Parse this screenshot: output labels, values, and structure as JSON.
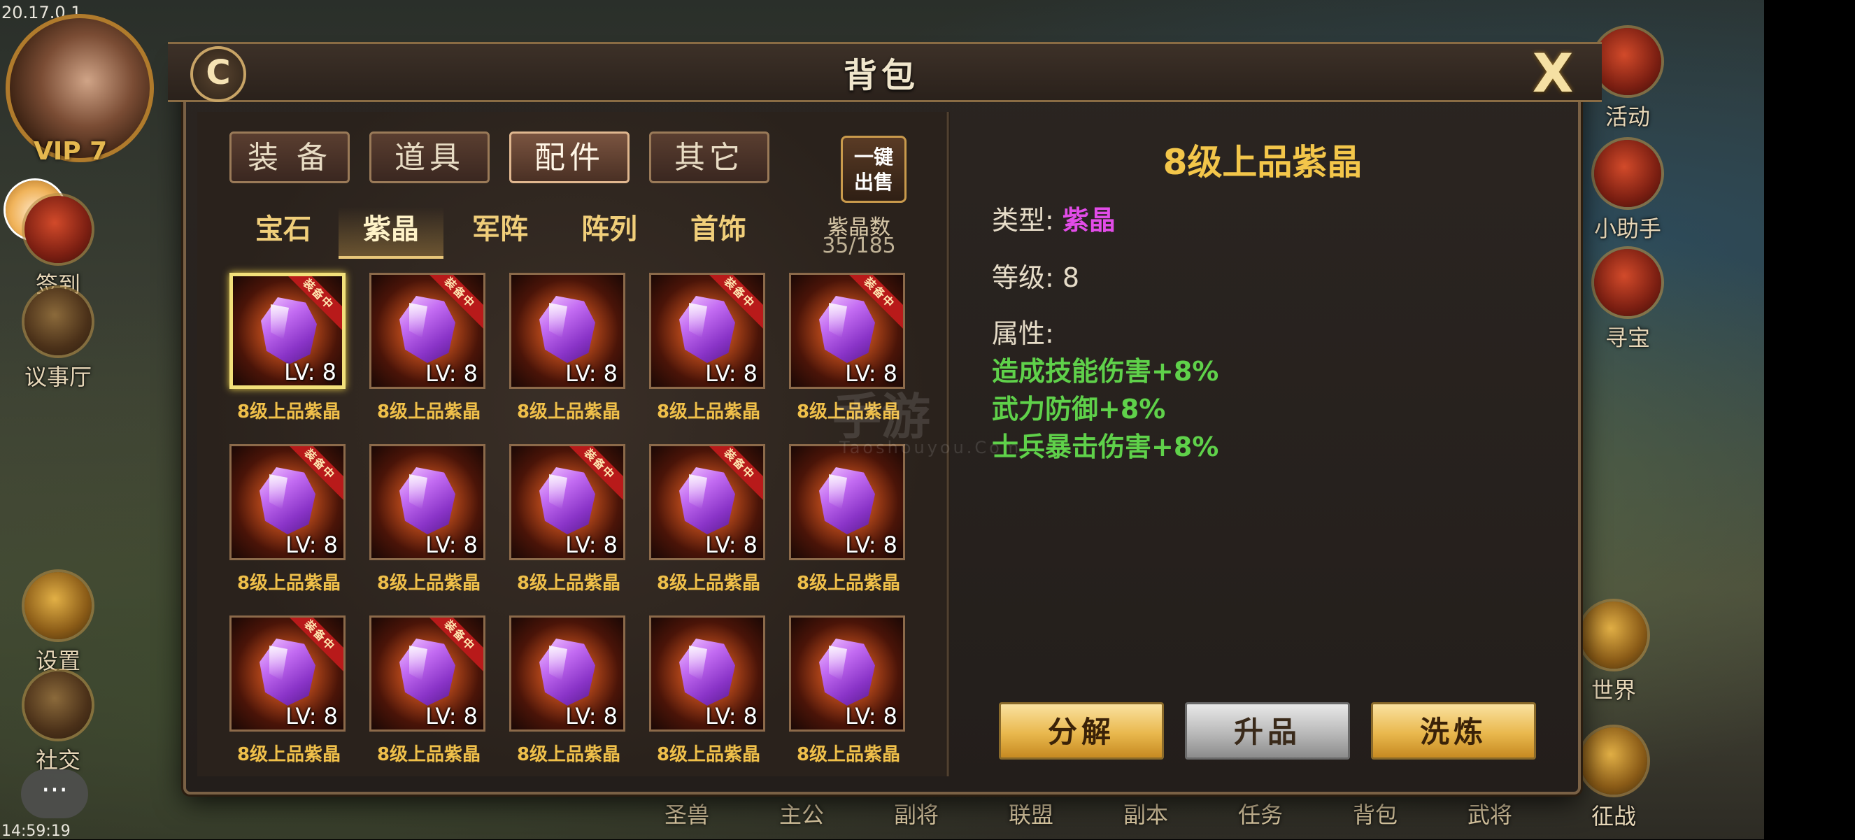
{
  "status": {
    "version": "20.17.0.1",
    "time": "14:59:19"
  },
  "hud": {
    "vip": "VIP 7",
    "left_buttons": [
      "签到",
      "议事厅",
      "设置",
      "社交"
    ],
    "right_buttons": [
      "活动",
      "小助手",
      "寻宝",
      "世界",
      "征战"
    ],
    "bottom_nav": [
      "圣兽",
      "主公",
      "副将",
      "联盟",
      "副本",
      "任务",
      "背包",
      "武将"
    ]
  },
  "dialog": {
    "title": "背包",
    "close_label": "X",
    "refresh_label": "C",
    "main_tabs": [
      "装 备",
      "道具",
      "配件",
      "其它"
    ],
    "active_main_tab": 2,
    "sell_button": {
      "line1": "一键",
      "line2": "出售"
    },
    "sub_tabs": [
      "宝石",
      "紫晶",
      "军阵",
      "阵列",
      "首饰"
    ],
    "active_sub_tab": 1,
    "count": {
      "label": "紫晶数",
      "value": "35/185"
    },
    "items": [
      {
        "name": "8级上品紫晶",
        "level": "LV: 8",
        "equipped": true,
        "selected": true
      },
      {
        "name": "8级上品紫晶",
        "level": "LV: 8",
        "equipped": true,
        "selected": false
      },
      {
        "name": "8级上品紫晶",
        "level": "LV: 8",
        "equipped": false,
        "selected": false
      },
      {
        "name": "8级上品紫晶",
        "level": "LV: 8",
        "equipped": true,
        "selected": false
      },
      {
        "name": "8级上品紫晶",
        "level": "LV: 8",
        "equipped": true,
        "selected": false
      },
      {
        "name": "8级上品紫晶",
        "level": "LV: 8",
        "equipped": true,
        "selected": false
      },
      {
        "name": "8级上品紫晶",
        "level": "LV: 8",
        "equipped": false,
        "selected": false
      },
      {
        "name": "8级上品紫晶",
        "level": "LV: 8",
        "equipped": true,
        "selected": false
      },
      {
        "name": "8级上品紫晶",
        "level": "LV: 8",
        "equipped": true,
        "selected": false
      },
      {
        "name": "8级上品紫晶",
        "level": "LV: 8",
        "equipped": false,
        "selected": false
      },
      {
        "name": "8级上品紫晶",
        "level": "LV: 8",
        "equipped": true,
        "selected": false
      },
      {
        "name": "8级上品紫晶",
        "level": "LV: 8",
        "equipped": true,
        "selected": false
      },
      {
        "name": "8级上品紫晶",
        "level": "LV: 8",
        "equipped": false,
        "selected": false
      },
      {
        "name": "8级上品紫晶",
        "level": "LV: 8",
        "equipped": false,
        "selected": false
      },
      {
        "name": "8级上品紫晶",
        "level": "LV: 8",
        "equipped": false,
        "selected": false
      }
    ],
    "equipped_tag": "装备中",
    "detail": {
      "title": "8级上品紫晶",
      "type_label": "类型:",
      "type_value": "紫晶",
      "level_label": "等级:",
      "level_value": "8",
      "attr_label": "属性:",
      "attributes": [
        "造成技能伤害+8%",
        "武力防御+8%",
        "士兵暴击伤害+8%"
      ]
    },
    "actions": [
      "分解",
      "升品",
      "洗炼"
    ]
  },
  "colors": {
    "gold_text": "#f0c04a",
    "purple_value": "#e24ce8",
    "attr_green": "#5fd14a",
    "ribbon_red": "#b81a1a"
  }
}
